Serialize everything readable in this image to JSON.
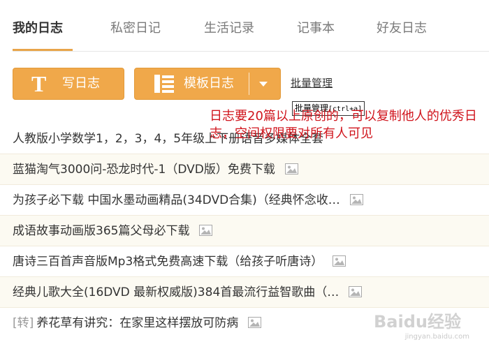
{
  "tabs": [
    {
      "label": "我的日志",
      "active": true
    },
    {
      "label": "私密日记",
      "active": false
    },
    {
      "label": "生活记录",
      "active": false
    },
    {
      "label": "记事本",
      "active": false
    },
    {
      "label": "好友日志",
      "active": false
    }
  ],
  "toolbar": {
    "write_label": "写日志",
    "template_label": "模板日志",
    "batch_manage_label": "批量管理"
  },
  "tooltip": {
    "text": "批量管理",
    "hotkey": "[ctrl+a]"
  },
  "overlay_note": "日志要20篇以上原创的，可以复制他人的优秀日志，空间权限要对所有人可见",
  "list": [
    {
      "title": "人教版小学数学1，2，3，4，5年级上下册语音多媒体全套",
      "repost": "",
      "has_image": false
    },
    {
      "title": "蓝猫淘气3000问-恐龙时代-1（DVD版）免费下载",
      "repost": "",
      "has_image": true
    },
    {
      "title": "为孩子必下载 中国水墨动画精品(34DVD合集)（经典怀念收…",
      "repost": "",
      "has_image": true
    },
    {
      "title": "成语故事动画版365篇父母必下载",
      "repost": "",
      "has_image": true
    },
    {
      "title": "唐诗三百首声音版Mp3格式免费高速下载（给孩子听唐诗）",
      "repost": "",
      "has_image": true
    },
    {
      "title": "经典儿歌大全(16DVD 最新权威版)384首最流行益智歌曲（…",
      "repost": "",
      "has_image": true
    },
    {
      "title": "养花草有讲究：在家里这样摆放可防病",
      "repost": "[转]",
      "has_image": true
    }
  ],
  "watermark": {
    "brand": "Baidu经验",
    "url": "jingyan.baidu.com"
  },
  "colors": {
    "accent": "#f0a84a",
    "tab_underline": "#e8a54a",
    "note_red": "#d0141c",
    "row_alt": "#fcfaf2"
  }
}
